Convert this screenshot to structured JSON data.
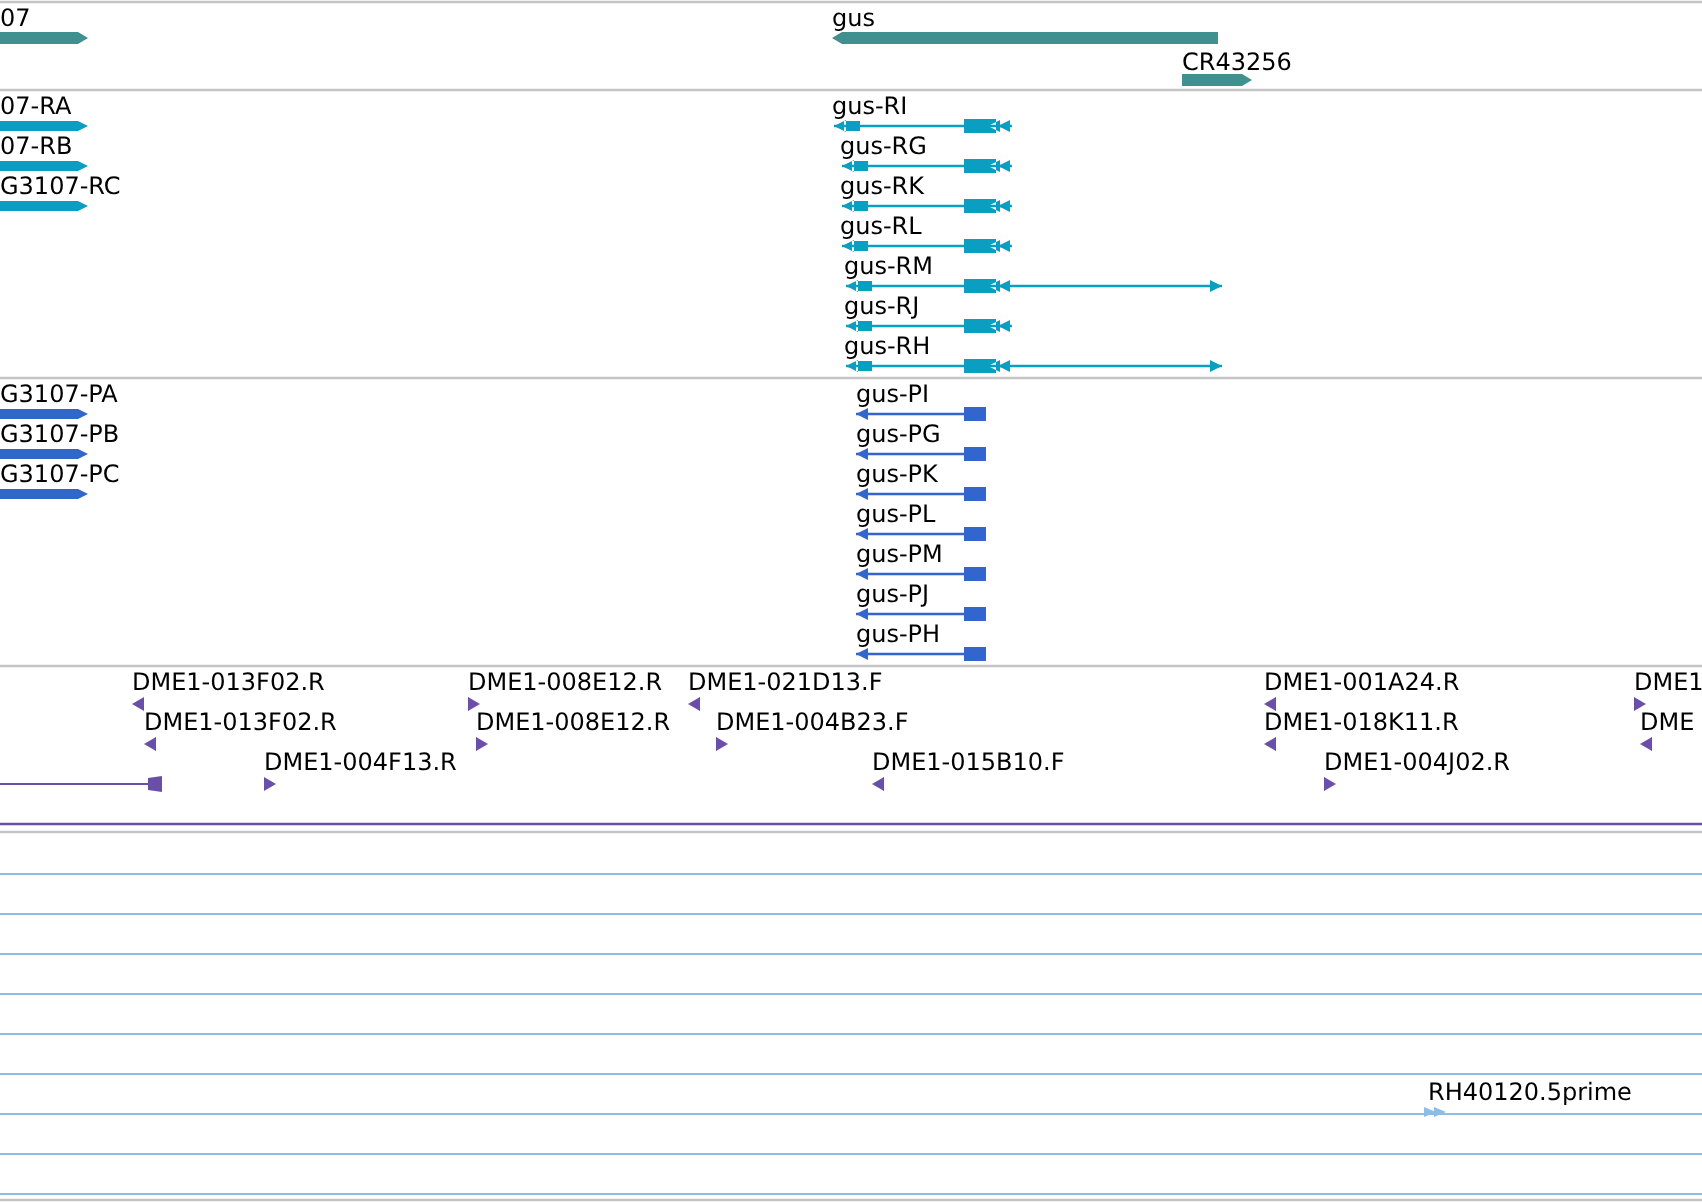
{
  "tracks": [
    {
      "kind": "gene",
      "features": [
        {
          "label": "07",
          "reverse": false
        },
        {
          "label": "gus",
          "reverse": true
        },
        {
          "label": "CR43256",
          "reverse": false
        }
      ]
    },
    {
      "kind": "transcript",
      "features": [
        {
          "label": "07-RA",
          "reverse": false
        },
        {
          "label": "07-RB",
          "reverse": false
        },
        {
          "label": "G3107-RC",
          "reverse": false
        },
        {
          "label": "gus-RI",
          "reverse": true
        },
        {
          "label": "gus-RG",
          "reverse": true
        },
        {
          "label": "gus-RK",
          "reverse": true
        },
        {
          "label": "gus-RL",
          "reverse": true
        },
        {
          "label": "gus-RM",
          "reverse": true
        },
        {
          "label": "gus-RJ",
          "reverse": true
        },
        {
          "label": "gus-RH",
          "reverse": true
        }
      ]
    },
    {
      "kind": "cds",
      "features": [
        {
          "label": "G3107-PA",
          "reverse": false
        },
        {
          "label": "G3107-PB",
          "reverse": false
        },
        {
          "label": "G3107-PC",
          "reverse": false
        },
        {
          "label": "gus-PI",
          "reverse": true
        },
        {
          "label": "gus-PG",
          "reverse": true
        },
        {
          "label": "gus-PK",
          "reverse": true
        },
        {
          "label": "gus-PL",
          "reverse": true
        },
        {
          "label": "gus-PM",
          "reverse": true
        },
        {
          "label": "gus-PJ",
          "reverse": true
        },
        {
          "label": "gus-PH",
          "reverse": true
        }
      ]
    },
    {
      "kind": "clone",
      "features": [
        {
          "label": "DME1-013F02.R",
          "reverse": true
        },
        {
          "label": "DME1-008E12.R",
          "reverse": false
        },
        {
          "label": "DME1-021D13.F",
          "reverse": true
        },
        {
          "label": "DME1-001A24.R",
          "reverse": true
        },
        {
          "label": "DME1",
          "reverse": false
        },
        {
          "label": "DME1-013F02.R",
          "reverse": true
        },
        {
          "label": "DME1-008E12.R",
          "reverse": false
        },
        {
          "label": "DME1-004B23.F",
          "reverse": false
        },
        {
          "label": "DME1-018K11.R",
          "reverse": true
        },
        {
          "label": "DME",
          "reverse": true
        },
        {
          "label": "DME1-004F13.R",
          "reverse": false
        },
        {
          "label": "DME1-015B10.F",
          "reverse": true
        },
        {
          "label": "DME1-004J02.R",
          "reverse": false
        }
      ]
    },
    {
      "kind": "est",
      "features": [
        {
          "label": "RH40120.5prime",
          "reverse": false
        }
      ]
    }
  ]
}
